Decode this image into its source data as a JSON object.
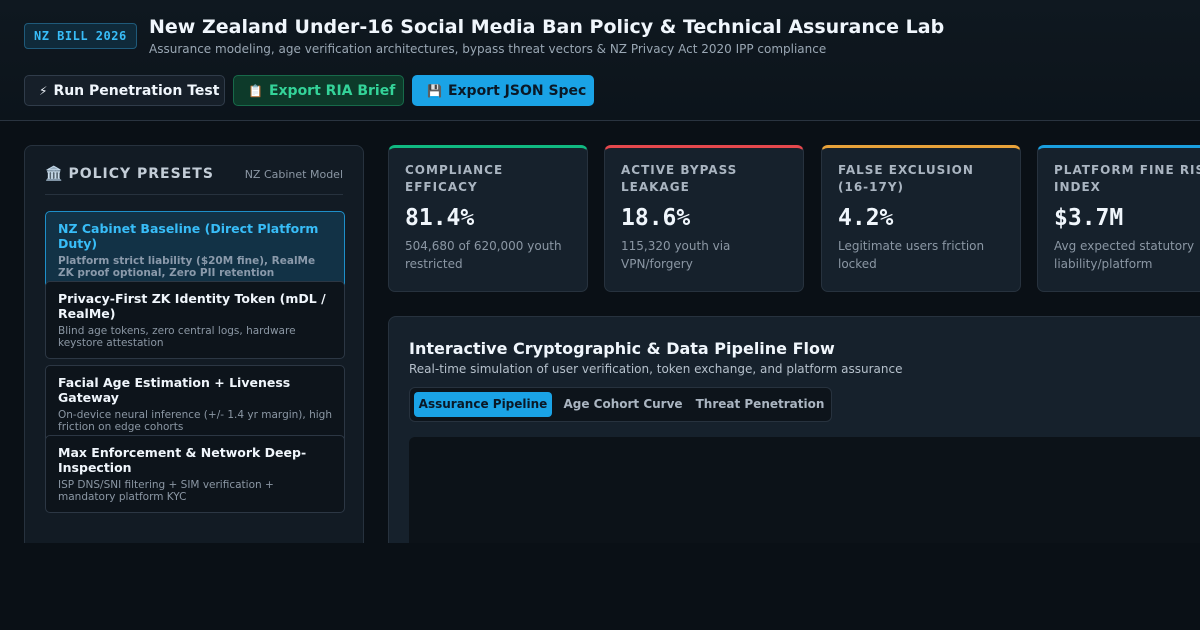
{
  "header": {
    "badge": "NZ BILL 2026",
    "title": "New Zealand Under-16 Social Media Ban Policy & Technical Assurance Lab",
    "subtitle": "Assurance modeling, age verification architectures, bypass threat vectors & NZ Privacy Act 2020 IPP compliance"
  },
  "toolbar": {
    "pen_test": {
      "icon": "⚡",
      "label": "Run Penetration Test"
    },
    "export_ria": {
      "icon": "📋",
      "label": "Export RIA Brief"
    },
    "export_json": {
      "icon": "💾",
      "label": "Export JSON Spec"
    }
  },
  "presets": {
    "icon": "🏛️",
    "title": "POLICY PRESETS",
    "model": "NZ Cabinet Model",
    "items": [
      {
        "name": "NZ Cabinet Baseline (Direct Platform Duty)",
        "desc": "Platform strict liability ($20M fine), RealMe ZK proof optional, Zero PII retention",
        "active": true
      },
      {
        "name": "Privacy-First ZK Identity Token (mDL / RealMe)",
        "desc": "Blind age tokens, zero central logs, hardware keystore attestation",
        "active": false
      },
      {
        "name": "Facial Age Estimation + Liveness Gateway",
        "desc": "On-device neural inference (+/- 1.4 yr margin), high friction on edge cohorts",
        "active": false
      },
      {
        "name": "Max Enforcement & Network Deep-Inspection",
        "desc": "ISP DNS/SNI filtering + SIM verification + mandatory platform KYC",
        "active": false
      }
    ]
  },
  "metrics": [
    {
      "label": "COMPLIANCE EFFICACY",
      "value": "81.4%",
      "sub": "504,680 of 620,000 youth restricted",
      "color": "#10b981"
    },
    {
      "label": "ACTIVE BYPASS LEAKAGE",
      "value": "18.6%",
      "sub": "115,320 youth via VPN/forgery",
      "color": "#e5484d"
    },
    {
      "label": "FALSE EXCLUSION (16-17Y)",
      "value": "4.2%",
      "sub": "Legitimate users friction locked",
      "color": "#e8a23a"
    },
    {
      "label": "PLATFORM FINE RISK INDEX",
      "value": "$3.7M",
      "sub": "Avg expected statutory liability/platform",
      "color": "#1a9fe0"
    }
  ],
  "pipeline": {
    "title": "Interactive Cryptographic & Data Pipeline Flow",
    "subtitle": "Real-time simulation of user verification, token exchange, and platform assurance",
    "tabs": [
      {
        "label": "Assurance Pipeline",
        "active": true
      },
      {
        "label": "Age Cohort Curve",
        "active": false
      },
      {
        "label": "Threat Penetration",
        "active": false
      }
    ]
  }
}
